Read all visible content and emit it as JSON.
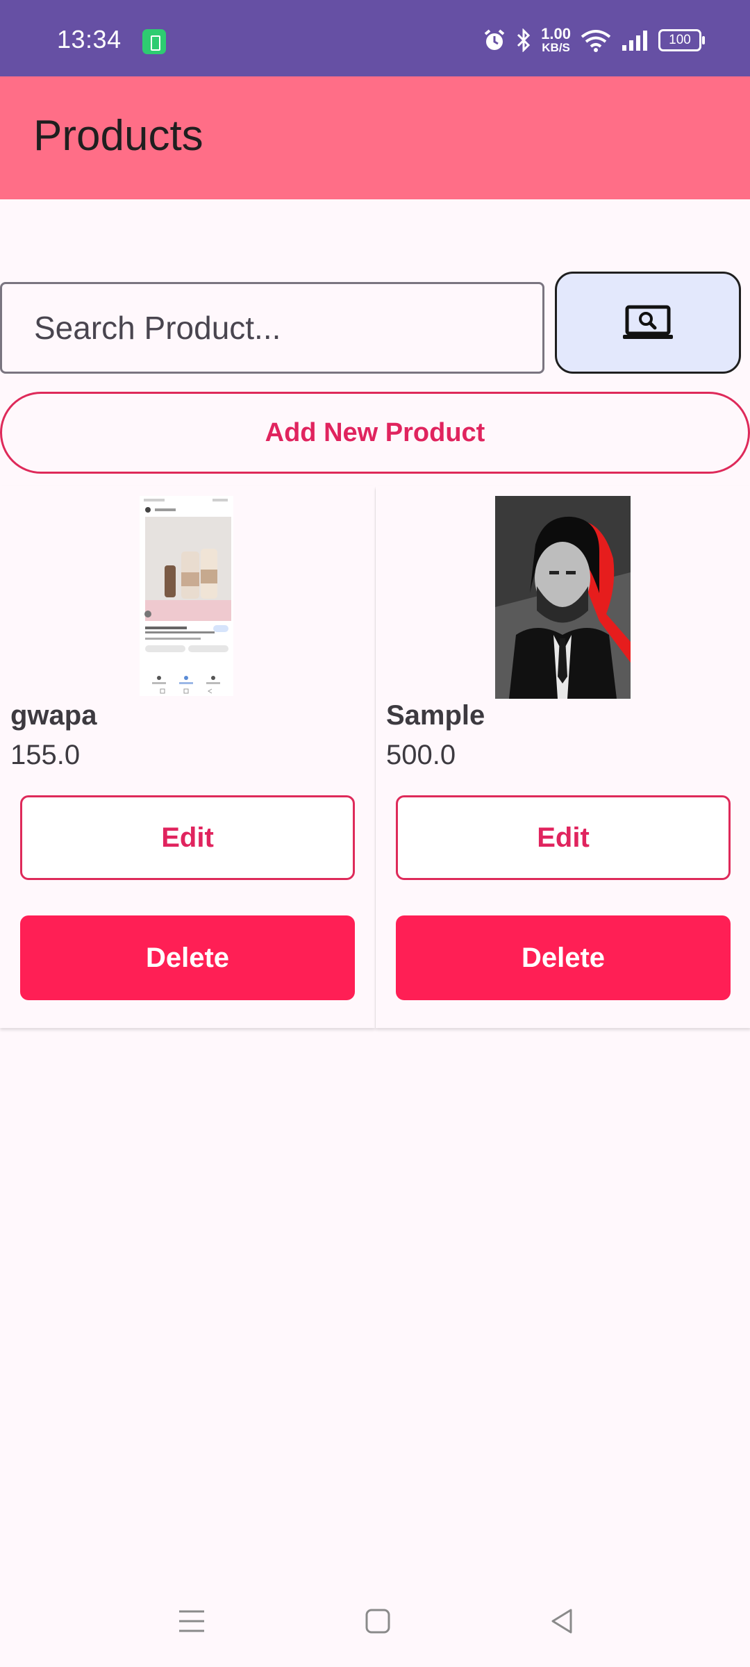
{
  "status_bar": {
    "time": "13:34",
    "network_speed_value": "1.00",
    "network_speed_unit": "KB/S",
    "battery_level": "100",
    "icons": [
      "battery-saver-icon",
      "alarm-icon",
      "bluetooth-icon",
      "wifi-icon",
      "signal-icon"
    ]
  },
  "app_bar": {
    "title": "Products",
    "color": "#ff6e87"
  },
  "search": {
    "placeholder": "Search Product...",
    "value": "",
    "button_icon": "laptop-search-icon"
  },
  "add_button_label": "Add New Product",
  "products": [
    {
      "name": "gwapa",
      "price": "155.0",
      "edit_label": "Edit",
      "delete_label": "Delete"
    },
    {
      "name": "Sample",
      "price": "500.0",
      "edit_label": "Edit",
      "delete_label": "Delete"
    }
  ],
  "nav_bar": {
    "icons": [
      "menu-icon",
      "home-icon",
      "back-icon"
    ]
  },
  "colors": {
    "status_bar": "#6650a4",
    "accent": "#e0245e",
    "delete": "#ff1f55"
  }
}
